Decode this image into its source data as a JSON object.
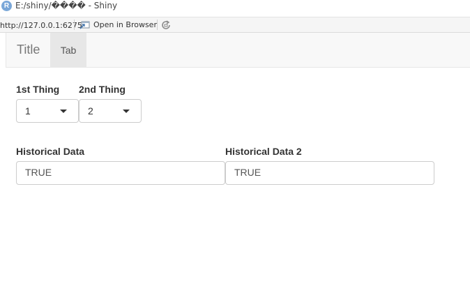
{
  "window": {
    "app_icon_letter": "R",
    "title": "E:/shiny/���� - Shiny"
  },
  "toolbar": {
    "url": "http://127.0.0.1:6275",
    "open_in_browser_label": "Open in Browser"
  },
  "navbar": {
    "brand": "Title",
    "tabs": [
      {
        "label": "Tab"
      }
    ]
  },
  "inputs": {
    "thing1": {
      "label": "1st Thing",
      "value": "1"
    },
    "thing2": {
      "label": "2nd Thing",
      "value": "2"
    },
    "historical_data": {
      "label": "Historical Data",
      "value": "TRUE"
    },
    "historical_data_2": {
      "label": "Historical Data 2",
      "value": "TRUE"
    }
  },
  "icons": {
    "app": "r-logo-icon",
    "browser": "browser-icon",
    "refresh": "refresh-icon",
    "dropdown": "caret-down-icon"
  }
}
